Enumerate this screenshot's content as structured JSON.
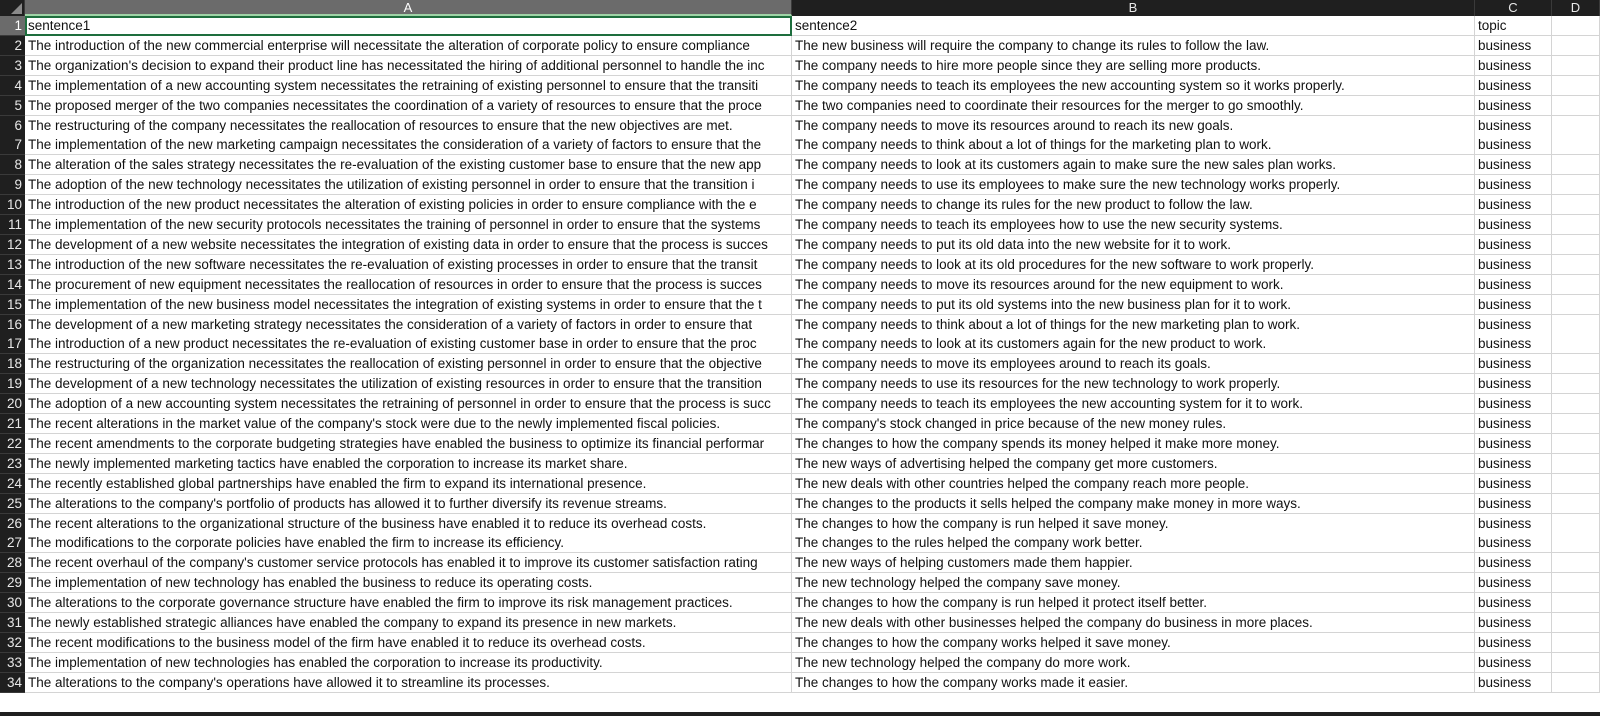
{
  "columns": {
    "a": "A",
    "b": "B",
    "c": "C",
    "d": "D"
  },
  "rows": [
    {
      "n": "1",
      "a": "sentence1",
      "b": "sentence2",
      "c": "topic"
    },
    {
      "n": "2",
      "a": "The introduction of the new commercial enterprise will necessitate the alteration of corporate policy to ensure compliance",
      "b": "The new business will require the company to change its rules to follow the law.",
      "c": "business"
    },
    {
      "n": "3",
      "a": "The organization's decision to expand their product line has necessitated the hiring of additional personnel to handle the inc",
      "b": "The company needs to hire more people since they are selling more products.",
      "c": "business"
    },
    {
      "n": "4",
      "a": "The implementation of a new accounting system necessitates the retraining of existing personnel to ensure that the transiti",
      "b": "The company needs to teach its employees the new accounting system so it works properly.",
      "c": "business"
    },
    {
      "n": "5",
      "a": "The proposed merger of the two companies necessitates the coordination of a variety of resources to ensure that the proce",
      "b": "The two companies need to coordinate their resources for the merger to go smoothly.",
      "c": "business"
    },
    {
      "n": "6",
      "a": "The restructuring of the company necessitates the reallocation of resources to ensure that the new objectives are met.",
      "b": "The company needs to move its resources around to reach its new goals.",
      "c": "business"
    },
    {
      "n": "7",
      "a": "The implementation of the new marketing campaign necessitates the consideration of a variety of factors to ensure that the",
      "b": "The company needs to think about a lot of things for the marketing plan to work.",
      "c": "business"
    },
    {
      "n": "8",
      "a": "The alteration of the sales strategy necessitates the re-evaluation of the existing customer base to ensure that the new app",
      "b": "The company needs to look at its customers again to make sure the new sales plan works.",
      "c": "business"
    },
    {
      "n": "9",
      "a": "The adoption of the new technology necessitates the utilization of existing personnel in order to ensure that the transition i",
      "b": "The company needs to use its employees to make sure the new technology works properly.",
      "c": "business"
    },
    {
      "n": "10",
      "a": "The introduction of the new product necessitates the alteration of existing policies in order to ensure compliance with the e",
      "b": "The company needs to change its rules for the new product to follow the law.",
      "c": "business"
    },
    {
      "n": "11",
      "a": "The implementation of the new security protocols necessitates the training of personnel in order to ensure that the systems",
      "b": "The company needs to teach its employees how to use the new security systems.",
      "c": "business"
    },
    {
      "n": "12",
      "a": "The development of a new website necessitates the integration of existing data in order to ensure that the process is succes",
      "b": "The company needs to put its old data into the new website for it to work.",
      "c": "business"
    },
    {
      "n": "13",
      "a": "The introduction of the new software necessitates the re-evaluation of existing processes in order to ensure that the transit",
      "b": "The company needs to look at its old procedures for the new software to work properly.",
      "c": "business"
    },
    {
      "n": "14",
      "a": "The procurement of new equipment necessitates the reallocation of resources in order to ensure that the process is succes",
      "b": "The company needs to move its resources around for the new equipment to work.",
      "c": "business"
    },
    {
      "n": "15",
      "a": "The implementation of the new business model necessitates the integration of existing systems in order to ensure that the t",
      "b": "The company needs to put its old systems into the new business plan for it to work.",
      "c": "business"
    },
    {
      "n": "16",
      "a": "The development of a new marketing strategy necessitates the consideration of a variety of factors in order to ensure that",
      "b": "The company needs to think about a lot of things for the new marketing plan to work.",
      "c": "business"
    },
    {
      "n": "17",
      "a": "The introduction of a new product necessitates the re-evaluation of existing customer base in order to ensure that the proc",
      "b": "The company needs to look at its customers again for the new product to work.",
      "c": "business"
    },
    {
      "n": "18",
      "a": "The restructuring of the organization necessitates the reallocation of existing personnel in order to ensure that the objective",
      "b": "The company needs to move its employees around to reach its goals.",
      "c": "business"
    },
    {
      "n": "19",
      "a": "The development of a new technology necessitates the utilization of existing resources in order to ensure that the transition",
      "b": "The company needs to use its resources for the new technology to work properly.",
      "c": "business"
    },
    {
      "n": "20",
      "a": "The adoption of a new accounting system necessitates the retraining of personnel in order to ensure that the process is succ",
      "b": "The company needs to teach its employees the new accounting system for it to work.",
      "c": "business"
    },
    {
      "n": "21",
      "a": "The recent alterations in the market value of the company's stock were due to the newly implemented fiscal policies.",
      "b": "The company's stock changed in price because of the new money rules.",
      "c": "business"
    },
    {
      "n": "22",
      "a": "The recent amendments to the corporate budgeting strategies have enabled the business to optimize its financial performar",
      "b": "The changes to how the company spends its money helped it make more money.",
      "c": "business"
    },
    {
      "n": "23",
      "a": "The newly implemented marketing tactics have enabled the corporation to increase its market share.",
      "b": "The new ways of advertising helped the company get more customers.",
      "c": "business"
    },
    {
      "n": "24",
      "a": "The recently established global partnerships have enabled the firm to expand its international presence.",
      "b": "The new deals with other countries helped the company reach more people.",
      "c": "business"
    },
    {
      "n": "25",
      "a": "The alterations to the company's portfolio of products has allowed it to further diversify its revenue streams.",
      "b": "The changes to the products it sells helped the company make money in more ways.",
      "c": "business"
    },
    {
      "n": "26",
      "a": "The recent alterations to the organizational structure of the business have enabled it to reduce its overhead costs.",
      "b": "The changes to how the company is run helped it save money.",
      "c": "business"
    },
    {
      "n": "27",
      "a": "The modifications to the corporate policies have enabled the firm to increase its efficiency.",
      "b": "The changes to the rules helped the company work better.",
      "c": "business"
    },
    {
      "n": "28",
      "a": "The recent overhaul of the company's customer service protocols has enabled it to improve its customer satisfaction rating",
      "b": "The new ways of helping customers made them happier.",
      "c": "business"
    },
    {
      "n": "29",
      "a": "The implementation of new technology has enabled the business to reduce its operating costs.",
      "b": "The new technology helped the company save money.",
      "c": "business"
    },
    {
      "n": "30",
      "a": "The alterations to the corporate governance structure have enabled the firm to improve its risk management practices.",
      "b": "The changes to how the company is run helped it protect itself better.",
      "c": "business"
    },
    {
      "n": "31",
      "a": "The newly established strategic alliances have enabled the company to expand its presence in new markets.",
      "b": "The new deals with other businesses helped the company do business in more places.",
      "c": "business"
    },
    {
      "n": "32",
      "a": "The recent modifications to the business model of the firm have enabled it to reduce its overhead costs.",
      "b": "The changes to how the company works helped it save money.",
      "c": "business"
    },
    {
      "n": "33",
      "a": "The implementation of new technologies has enabled the corporation to increase its productivity.",
      "b": "The new technology helped the company do more work.",
      "c": "business"
    },
    {
      "n": "34",
      "a": "The alterations to the company's operations have allowed it to streamline its processes.",
      "b": "The changes to how the company works made it easier.",
      "c": "business"
    }
  ]
}
